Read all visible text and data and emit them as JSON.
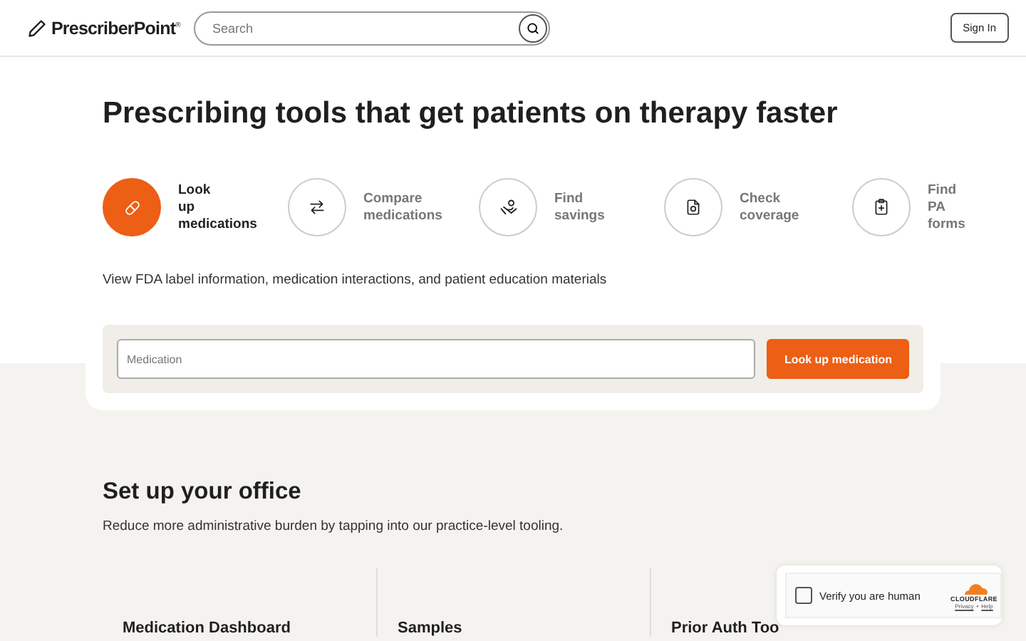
{
  "header": {
    "logo": "PrescriberPoint",
    "logo_mark": "®",
    "search": {
      "placeholder": "Search"
    },
    "sign_in": "Sign In"
  },
  "hero": {
    "title": "Prescribing tools that get patients on therapy faster",
    "tools": [
      {
        "label": "Look up medications",
        "selected": true,
        "kind": "pill"
      },
      {
        "label": "Compare medications",
        "selected": false,
        "kind": "arrows"
      },
      {
        "label": "Find savings",
        "selected": false,
        "kind": "savings"
      },
      {
        "label": "Check coverage",
        "selected": false,
        "kind": "coverage"
      },
      {
        "label": "Find PA forms",
        "selected": false,
        "kind": "clipboard"
      }
    ],
    "description": "View FDA label information, medication interactions, and patient education materials",
    "field": {
      "placeholder": "Medication"
    },
    "button": "Look up medication"
  },
  "office": {
    "title": "Set up your office",
    "subtitle": "Reduce more administrative burden by tapping into our practice-level tooling.",
    "cards": [
      "Medication Dashboard",
      "Samples",
      "Prior Auth Too"
    ]
  },
  "captcha": {
    "label": "Verify you are human",
    "checked": false,
    "brand": "CLOUDFLARE",
    "links": [
      "Privacy",
      "Help"
    ],
    "separator": "•"
  }
}
